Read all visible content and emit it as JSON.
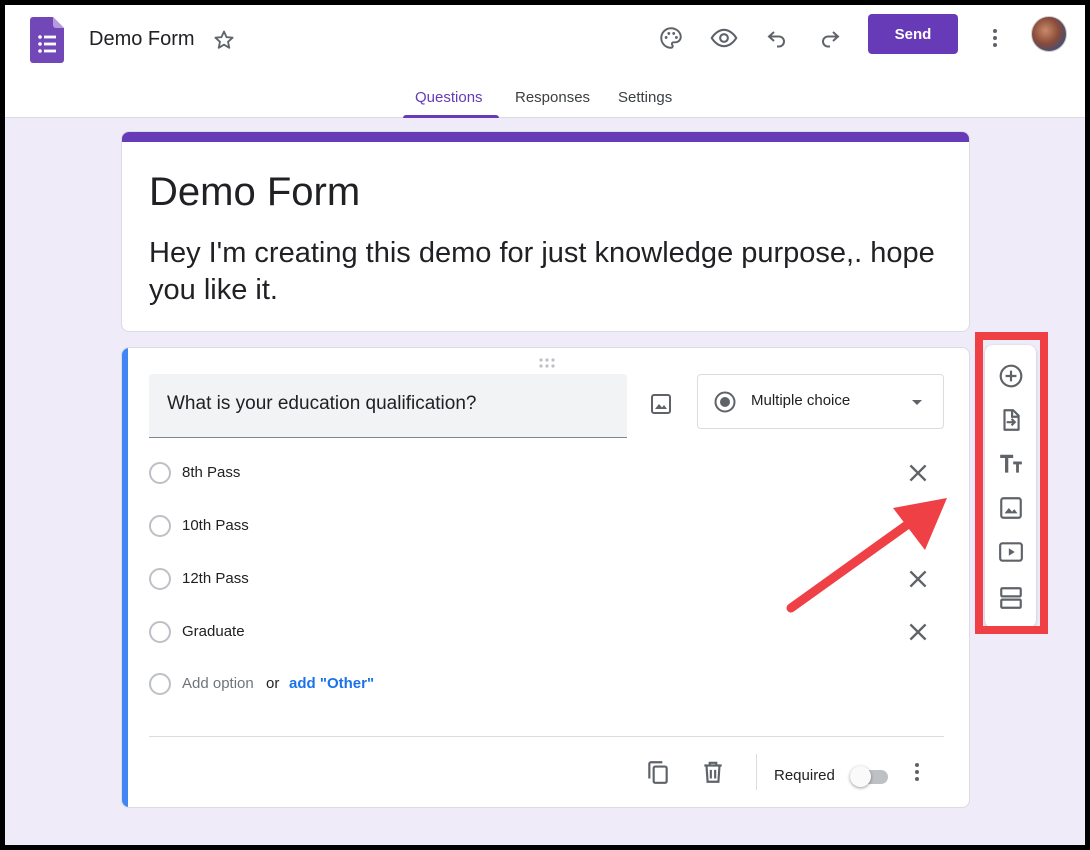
{
  "header": {
    "form_title": "Demo Form",
    "send_label": "Send"
  },
  "tabs": [
    {
      "label": "Questions",
      "active": true
    },
    {
      "label": "Responses",
      "active": false
    },
    {
      "label": "Settings",
      "active": false
    }
  ],
  "title_card": {
    "title": "Demo Form",
    "description": "Hey I'm creating this demo for just knowledge purpose,. hope you like it."
  },
  "question": {
    "text": "What is your education qualification?",
    "type": "Multiple choice",
    "options": [
      {
        "label": "8th Pass",
        "removable": true
      },
      {
        "label": "10th Pass",
        "removable": false
      },
      {
        "label": "12th Pass",
        "removable": true
      },
      {
        "label": "Graduate",
        "removable": true
      }
    ],
    "add_option": "Add option",
    "or": "or",
    "add_other": "add \"Other\"",
    "required_label": "Required",
    "required": false
  },
  "side_toolbar": [
    "add-question-icon",
    "import-questions-icon",
    "add-title-icon",
    "add-image-icon",
    "add-video-icon",
    "add-section-icon"
  ],
  "colors": {
    "primary": "#673ab7",
    "accent_blue": "#4285f4",
    "highlight_red": "#ee4045",
    "background": "#efebf8"
  }
}
